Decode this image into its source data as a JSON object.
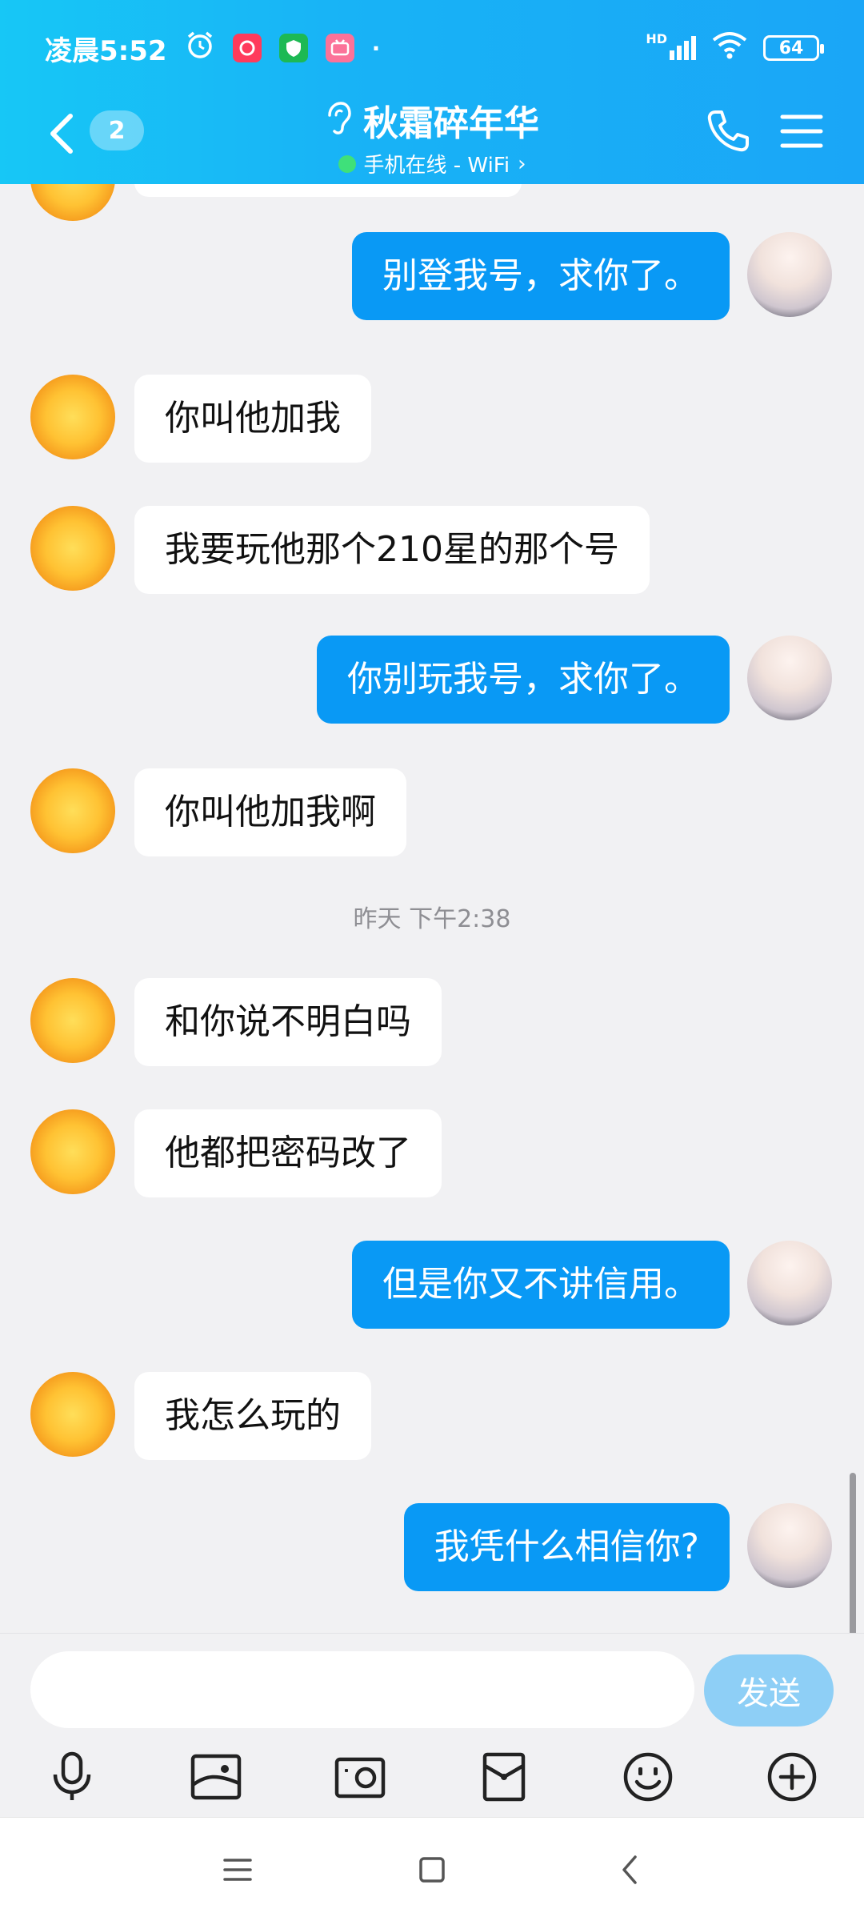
{
  "status_bar": {
    "time": "凌晨5:52",
    "network_label": "HD",
    "battery": "64"
  },
  "header": {
    "unread_count": "2",
    "title": "秋霜碎年华",
    "subtitle": "手机在线 - WiFi",
    "subtitle_chevron": "›"
  },
  "messages": [
    {
      "side": "self",
      "text": "别登我号，求你了。"
    },
    {
      "side": "other",
      "text": "你叫他加我"
    },
    {
      "side": "other",
      "text": "我要玩他那个210星的那个号"
    },
    {
      "side": "self",
      "text": "你别玩我号，求你了。"
    },
    {
      "side": "other",
      "text": "你叫他加我啊"
    },
    {
      "side": "other",
      "text": "和你说不明白吗"
    },
    {
      "side": "other",
      "text": "他都把密码改了"
    },
    {
      "side": "self",
      "text": "但是你又不讲信用。"
    },
    {
      "side": "other",
      "text": "我怎么玩的"
    },
    {
      "side": "self",
      "text": "我凭什么相信你?"
    }
  ],
  "timestamp": "昨天 下午2:38",
  "input": {
    "value": "",
    "placeholder": ""
  },
  "send_label": "发送",
  "toolbar_icons": [
    "microphone-icon",
    "image-icon",
    "camera-icon",
    "red-packet-icon",
    "emoji-icon",
    "plus-icon"
  ],
  "colors": {
    "header_start": "#17c7f6",
    "header_end": "#1aa6f7",
    "self_bubble": "#0999f5",
    "other_bubble": "#ffffff",
    "send_button": "#8ecff6",
    "online": "#3fe07a"
  }
}
